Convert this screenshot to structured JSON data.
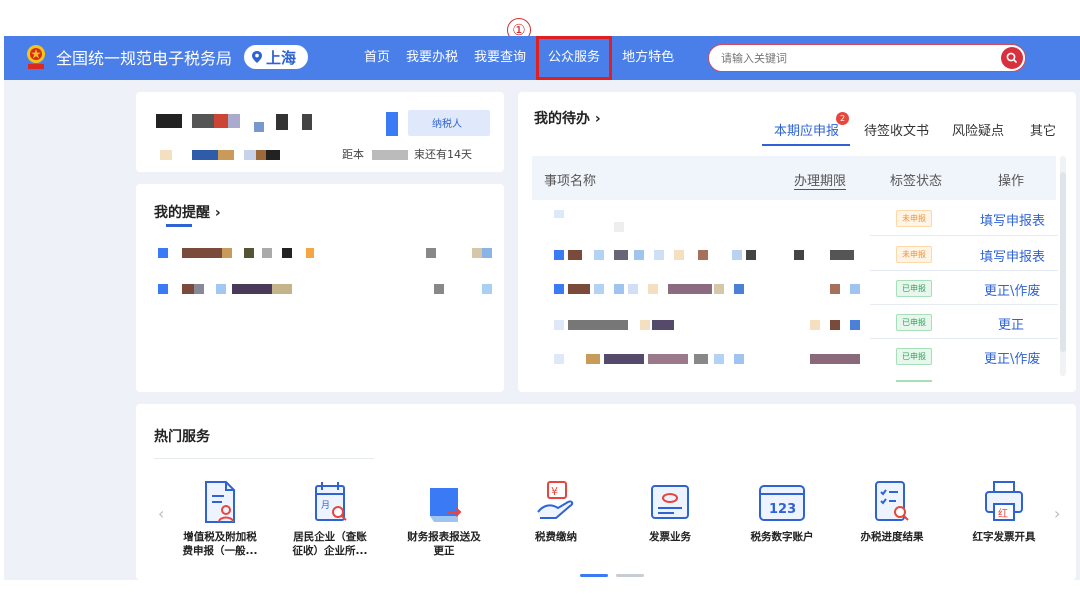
{
  "annotation": {
    "marker": "①"
  },
  "header": {
    "site_title": "全国统一规范电子税务局",
    "city": "上海",
    "nav": [
      "首页",
      "我要办税",
      "我要查询",
      "公众服务",
      "地方特色"
    ],
    "search_placeholder": "请输入关键词",
    "colors": {
      "bar": "#4a7ee8",
      "highlight": "#e02020",
      "search_button": "#d8313e"
    }
  },
  "account": {
    "taxpayer_badge": "纳税人",
    "deadline_text_prefix": "距本",
    "deadline_text_suffix": "束还有14天"
  },
  "reminders": {
    "title": "我的提醒 ›"
  },
  "todo": {
    "title": "我的待办 ›",
    "tabs": [
      "本期应申报",
      "待签收文书",
      "风险疑点",
      "其它"
    ],
    "tab_badge": "2",
    "columns": [
      "事项名称",
      "办理期限",
      "标签状态",
      "操作"
    ],
    "rows": [
      {
        "status": "未申报",
        "action": "填写申报表"
      },
      {
        "status": "未申报",
        "action": "填写申报表"
      },
      {
        "status": "已申报",
        "action": "更正\\作废"
      },
      {
        "status": "已申报",
        "action": "更正"
      },
      {
        "status": "已申报",
        "action": "更正\\作废"
      }
    ]
  },
  "hot_services": {
    "title": "热门服务",
    "items": [
      {
        "icon": "document-user-icon",
        "line1": "增值税及附加税",
        "line2": "费申报（一般..."
      },
      {
        "icon": "calendar-search-icon",
        "line1": "居民企业（查账",
        "line2": "征收）企业所..."
      },
      {
        "icon": "report-send-icon",
        "line1": "财务报表报送及",
        "line2": "更正"
      },
      {
        "icon": "fee-payment-icon",
        "line1": "税费缴纳",
        "line2": ""
      },
      {
        "icon": "invoice-icon",
        "line1": "发票业务",
        "line2": ""
      },
      {
        "icon": "digital-account-icon",
        "line1": "税务数字账户",
        "line2": ""
      },
      {
        "icon": "checklist-search-icon",
        "line1": "办税进度结果",
        "line2": ""
      },
      {
        "icon": "red-invoice-printer-icon",
        "line1": "红字发票开具",
        "line2": ""
      }
    ]
  }
}
